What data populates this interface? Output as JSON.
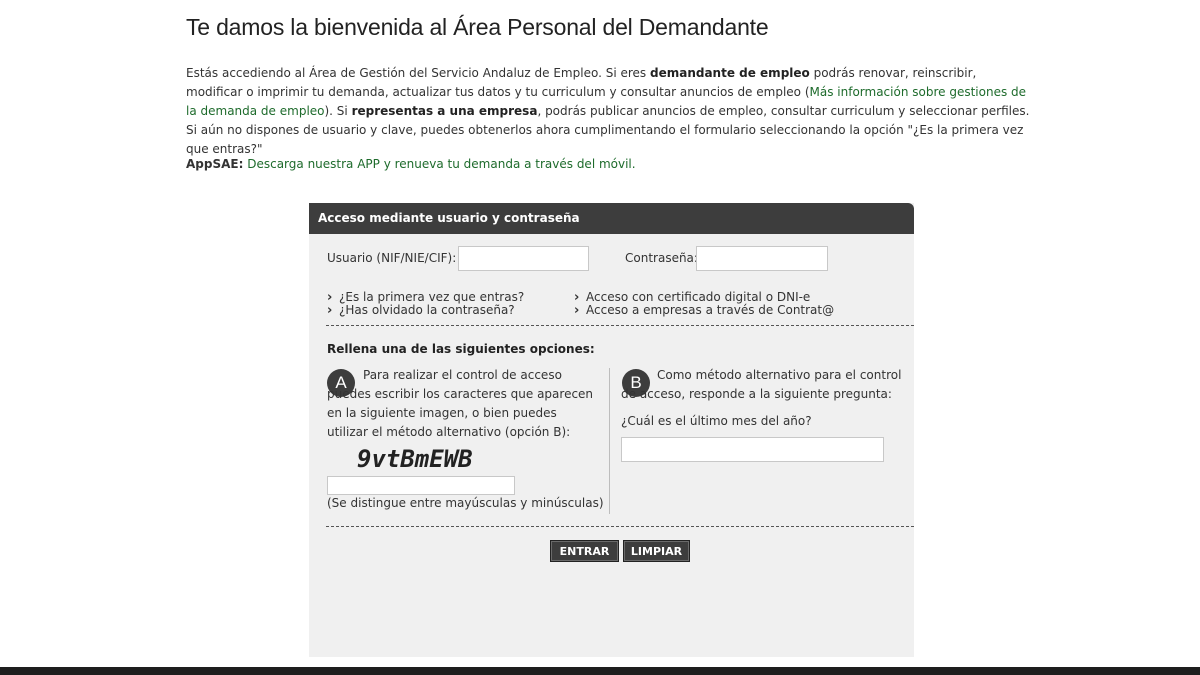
{
  "header": {
    "title": "Te damos la bienvenida al Área Personal del Demandante"
  },
  "intro": {
    "p1": "Estás accediendo al Área de Gestión del Servicio Andaluz de Empleo. Si eres ",
    "b1": "demandante de empleo",
    "p2": " podrás renovar, reinscribir, modificar o imprimir tu demanda, actualizar tus datos y tu curriculum y consultar anuncios de empleo (",
    "link1": "Más información sobre gestiones de la demanda de empleo",
    "p3": "). Si ",
    "b2": "representas a una empresa",
    "p4": ", podrás publicar anuncios de empleo, consultar curriculum y seleccionar perfiles. Si aún no dispones de usuario y clave, puedes obtenerlos ahora cumplimentando el formulario seleccionando la opción \"¿Es la primera vez que entras?\""
  },
  "appsae": {
    "label": "AppSAE:",
    "link": "Descarga nuestra APP y renueva tu demanda a través del móvil."
  },
  "login": {
    "title": "Acceso mediante usuario y contraseña",
    "user_label": "Usuario (NIF/NIE/CIF):",
    "user_value": "",
    "password_label": "Contraseña:",
    "password_value": "",
    "links": {
      "first_time": "¿Es la primera vez que entras?",
      "forgot": "¿Has olvidado la contraseña?",
      "certificate": "Acceso con certificado digital o DNI-e",
      "contrata": "Acceso a empresas a través de Contrat@"
    },
    "options_title": "Rellena una de las siguientes opciones:",
    "option_a": {
      "badge": "A",
      "text": "Para realizar el control de acceso puedes escribir los caracteres que aparecen en la siguiente imagen, o bien puedes utilizar el método alternativo (opción B):",
      "captcha": "9vtBmEWB",
      "input_value": "",
      "hint": "(Se distingue entre mayúsculas y minúsculas)"
    },
    "option_b": {
      "badge": "B",
      "text": "Como método alternativo para el control de acceso, responde a la siguiente pregunta:",
      "question": "¿Cuál es el último mes del año?",
      "answer_value": ""
    },
    "buttons": {
      "enter": "ENTRAR",
      "clear": "LIMPIAR"
    }
  },
  "colors": {
    "panel_header": "#3d3d3d",
    "panel_bg": "#f0f0f0",
    "link_green": "#1e6b2c"
  }
}
